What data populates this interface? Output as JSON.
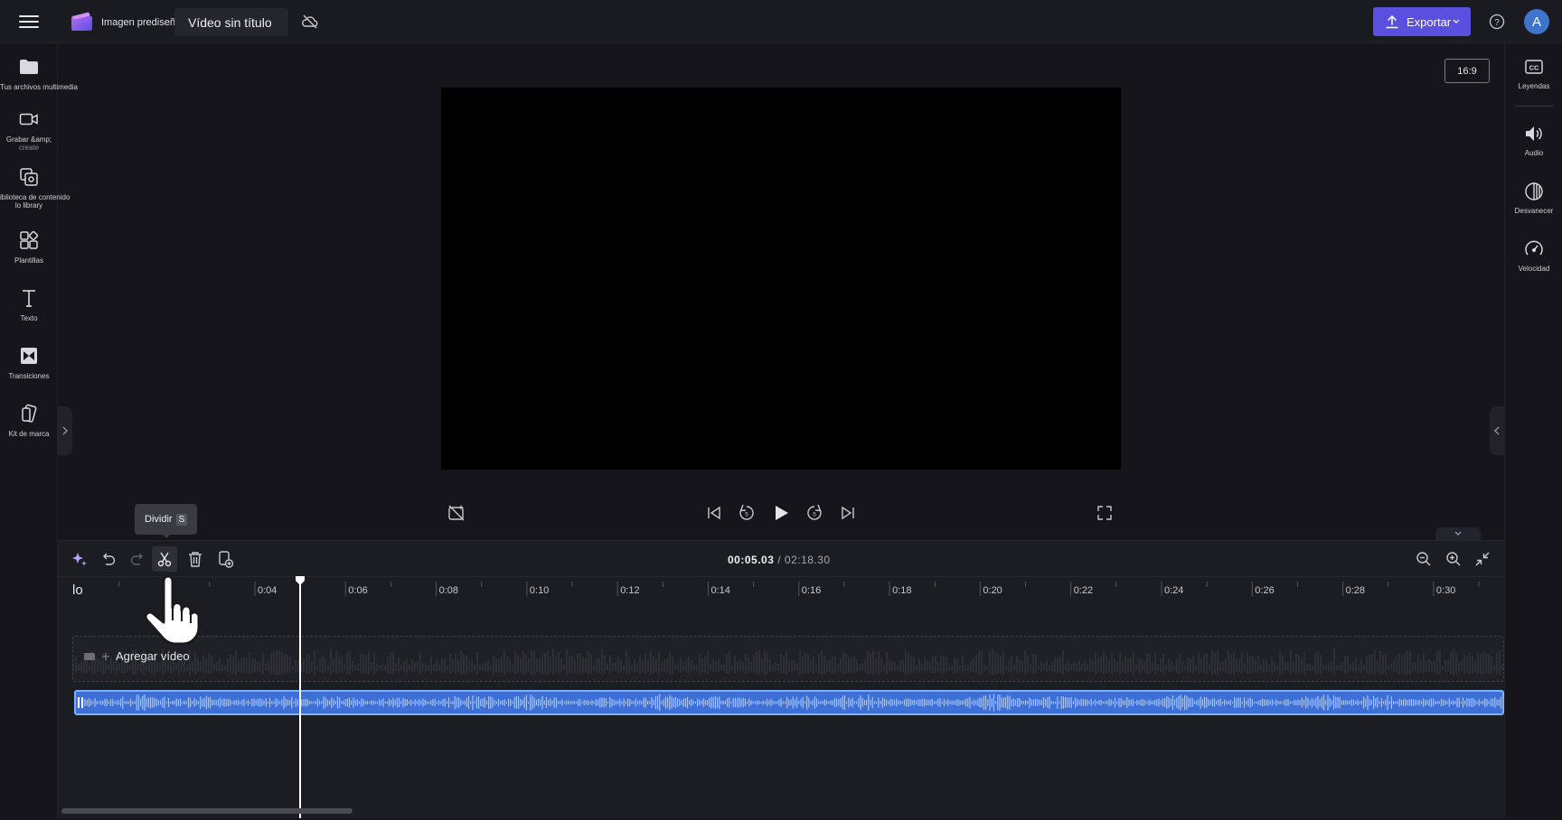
{
  "header": {
    "logo_label": "Imagen prediseñada",
    "title": "Vídeo sin título",
    "export_label": "Exportar",
    "avatar_initial": "A"
  },
  "sidebar_left": {
    "items": [
      {
        "label": "Tus archivos multimedia",
        "icon": "folder-icon"
      },
      {
        "label": "Grabar &amp;",
        "sublabel": "create",
        "icon": "camera-icon"
      },
      {
        "label": "iblioteca de contenido",
        "sublabel": "lo library",
        "icon": "content-library-icon"
      },
      {
        "label": "Plantillas",
        "icon": "templates-icon"
      },
      {
        "label": "Texto",
        "icon": "text-icon"
      },
      {
        "label": "Transiciones",
        "icon": "transitions-icon"
      },
      {
        "label": "Kit de marca",
        "icon": "brand-kit-icon"
      }
    ]
  },
  "sidebar_right": {
    "items": [
      {
        "label": "Leyendas",
        "icon": "captions-icon"
      },
      {
        "label": "Audio",
        "icon": "audio-icon"
      },
      {
        "label": "Desvanecer",
        "icon": "fade-icon"
      },
      {
        "label": "Velocidad",
        "icon": "speed-icon"
      }
    ]
  },
  "preview": {
    "aspect_ratio": "16:9"
  },
  "tooltip": {
    "label": "Dividir",
    "shortcut": "S"
  },
  "timeline": {
    "current_time": "00:05.03",
    "separator": " / ",
    "total_time": "02:18.30",
    "ruler_start": "lo",
    "ruler_labels": [
      "0:04",
      "0:06",
      "0:08",
      "0:10",
      "0:12",
      "0:14",
      "0:16",
      "0:18",
      "0:20",
      "0:22",
      "0:24",
      "0:26",
      "0:28",
      "0:30"
    ],
    "add_video_label": "Agregar vídeo"
  },
  "colors": {
    "accent": "#5b4fe0",
    "audio_clip": "#3d6fd6",
    "audio_clip_border": "#7ab2ff"
  }
}
